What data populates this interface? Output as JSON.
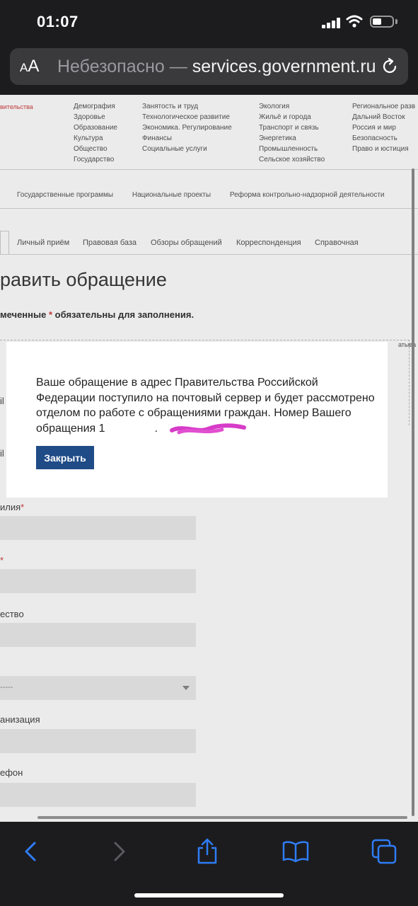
{
  "status_bar": {
    "time": "01:07"
  },
  "browser": {
    "aa_label_small": "A",
    "aa_label_large": "A",
    "insecure_label": "Небезопасно —",
    "domain": "services.government.ru"
  },
  "site": {
    "logo_caption": "вительства",
    "menu_columns": [
      [
        "Демография",
        "Здоровье",
        "Образование",
        "Культура",
        "Общество",
        "Государство"
      ],
      [
        "Занятость и труд",
        "Технологическое развитие",
        "Экономика. Регулирование",
        "Финансы",
        "Социальные услуги"
      ],
      [
        "Экология",
        "Жильё и города",
        "Транспорт и связь",
        "Энергетика",
        "Промышленность",
        "Сельское хозяйство"
      ],
      [
        "Региональное разв",
        "Дальний Восток",
        "Россия и мир",
        "Безопасность",
        "Право и юстиция"
      ]
    ],
    "program_nav": [
      "Государственные программы",
      "Национальные проекты",
      "Реформа контрольно-надзорной деятельности"
    ],
    "tabs": [
      "Личный приём",
      "Правовая база",
      "Обзоры обращений",
      "Корреспонденция",
      "Справочная"
    ],
    "page_heading": "равить обращение",
    "required_note_prefix": "меченные",
    "required_note_star": "*",
    "required_note_suffix": "обязательны для заполнения.",
    "right_fragment": "атыва",
    "form_fields": [
      {
        "label": "илия",
        "star": "*"
      },
      {
        "label": "",
        "star": "*"
      },
      {
        "label": "ество",
        "star": ""
      },
      {
        "label": "анизация",
        "star": ""
      },
      {
        "label": "ефон",
        "star": ""
      }
    ],
    "select_placeholder": "-----",
    "hidden_labels": [
      "il",
      "il"
    ]
  },
  "modal": {
    "message": "Ваше обращение в адрес Правительства Российской Федерации поступило на почтовый сервер и будет рассмотрено отделом по работе с обращениями граждан. Номер Вашего обращения 1",
    "message_end": ".",
    "close_label": "Закрыть"
  }
}
